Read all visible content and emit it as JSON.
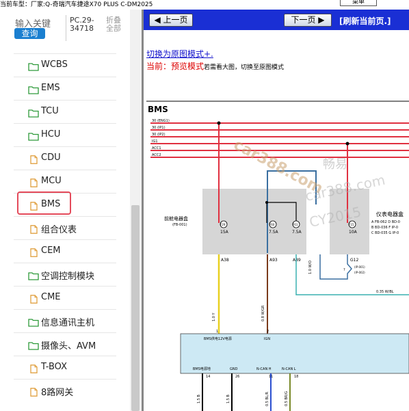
{
  "header": {
    "vehicle_text": "当前车型：厂家:Q-奇瑞汽车捷途X70 PLUS C-DM2025",
    "menu_label": "菜单"
  },
  "search": {
    "keyword_placeholder": "输入关键",
    "query_button": "查询",
    "code": "PC.29-34718",
    "fold_label": "折叠全部"
  },
  "sidebar": {
    "items": [
      {
        "label": "WCBS",
        "icon": "folder-icon"
      },
      {
        "label": "EMS",
        "icon": "folder-icon"
      },
      {
        "label": "TCU",
        "icon": "folder-icon"
      },
      {
        "label": "HCU",
        "icon": "folder-icon"
      },
      {
        "label": "CDU",
        "icon": "document-icon"
      },
      {
        "label": "MCU",
        "icon": "document-icon"
      },
      {
        "label": "BMS",
        "icon": "document-icon",
        "selected": true
      },
      {
        "label": "组合仪表",
        "icon": "document-icon"
      },
      {
        "label": "CEM",
        "icon": "document-icon"
      },
      {
        "label": "空调控制模块",
        "icon": "folder-icon"
      },
      {
        "label": "CME",
        "icon": "document-icon"
      },
      {
        "label": "信息通讯主机",
        "icon": "folder-icon"
      },
      {
        "label": "摄像头、AVM",
        "icon": "folder-icon"
      },
      {
        "label": "T-BOX",
        "icon": "document-icon"
      },
      {
        "label": "8路网关",
        "icon": "document-icon"
      }
    ],
    "highlight_color": "#e44a5a"
  },
  "toolbar": {
    "prev_label": "上一页",
    "next_label": "下一页",
    "refresh_label": "[刷新当前页.]",
    "nav_color": "#1a2fd4"
  },
  "mode": {
    "switch_link": "切换为原图模式+.",
    "current_label": "当前：预览模式",
    "current_hint": "若需看大图，切换至原图模式"
  },
  "diagram": {
    "title": "BMS",
    "power_lines": [
      "30 (ENG1)",
      "30 (IP1)",
      "30 (IP2)",
      "IG1",
      "ACC1",
      "ACC2"
    ],
    "front_fuse_box": {
      "label": "前舱电器盒",
      "code": "(FB-001)"
    },
    "fuses": [
      {
        "id": "F29",
        "rating": "15A"
      },
      {
        "id": "F60",
        "rating": "7.5A"
      },
      {
        "id": "F61",
        "rating": "7.5A"
      },
      {
        "id": "F15",
        "rating": "10A"
      }
    ],
    "pins": [
      "A38",
      "A93",
      "A89",
      "G12"
    ],
    "ip_fuse_box": {
      "label": "仪表电器盒",
      "lines": [
        "A FB-062 D BD-0",
        "B BD-036 F IP-0",
        "C BD-035 G IP-0"
      ],
      "codes": [
        "(IP-001)",
        "(IP-002)"
      ]
    },
    "wires": [
      "1.0 W/O",
      "0.35 W/BL",
      "1.0 Y",
      "0.8 W/GR"
    ],
    "module_labels": [
      "BMS供电12V电源",
      "IGN"
    ],
    "module_pins": [
      {
        "name": "BMS电源地",
        "num": "14",
        "wire": "1.5 B"
      },
      {
        "name": "GND",
        "num": "26",
        "wire": "1.5 B"
      },
      {
        "name": "N-CAN H",
        "num": "11",
        "wire": "0.5 BL/R"
      },
      {
        "name": "N-CAN L",
        "num": "18",
        "wire": "0.5 BR/G"
      }
    ],
    "module_pin_numbers_top": [
      "1",
      "2"
    ],
    "watermarks": [
      "car388.com",
      "畅易",
      "car388.com",
      "CY2015"
    ]
  }
}
